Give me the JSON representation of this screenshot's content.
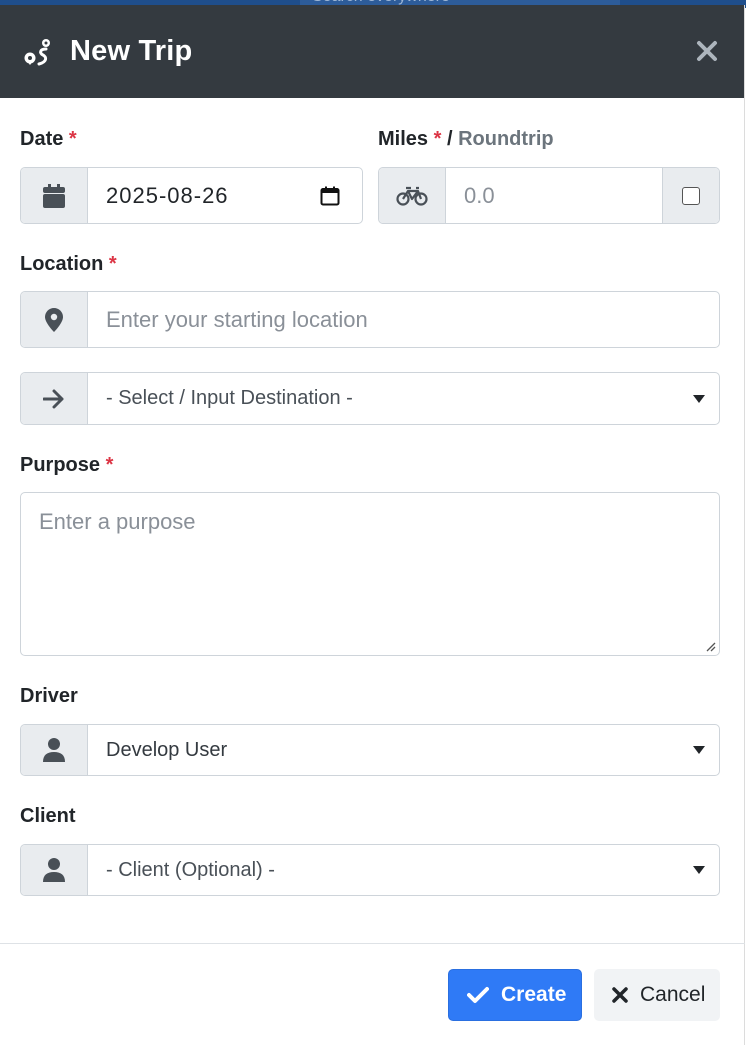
{
  "background": {
    "search_placeholder": "Search everywhere"
  },
  "modal": {
    "title": "New Trip",
    "title_icon": "route-icon",
    "close_icon": "close-icon"
  },
  "form": {
    "date": {
      "label": "Date",
      "required_mark": "*",
      "icon": "calendar-icon",
      "value": "2025-08-26",
      "picker_icon": "calendar-picker-icon"
    },
    "miles": {
      "label": "Miles",
      "required_mark": "*",
      "separator": "/",
      "roundtrip_label": "Roundtrip",
      "icon": "bicycle-icon",
      "placeholder": "0.0",
      "roundtrip_checked": false
    },
    "location": {
      "label": "Location",
      "required_mark": "*",
      "start_icon": "map-marker-icon",
      "start_placeholder": "Enter your starting location",
      "destination_icon": "arrow-right-icon",
      "destination_placeholder": "- Select / Input Destination -"
    },
    "purpose": {
      "label": "Purpose",
      "required_mark": "*",
      "placeholder": "Enter a purpose"
    },
    "driver": {
      "label": "Driver",
      "icon": "user-icon",
      "value": "Develop User"
    },
    "client": {
      "label": "Client",
      "icon": "user-icon",
      "placeholder": "- Client (Optional) -"
    }
  },
  "footer": {
    "create_label": "Create",
    "create_icon": "check-icon",
    "cancel_label": "Cancel",
    "cancel_icon": "x-icon"
  },
  "colors": {
    "header_bg": "#343a40",
    "primary": "#2f7af6",
    "required": "#dc3545",
    "muted": "#6c757d"
  }
}
